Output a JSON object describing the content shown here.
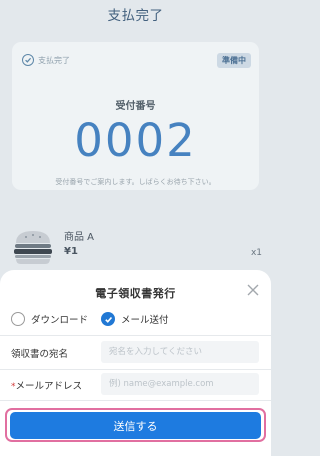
{
  "header": {
    "title": "支払完了"
  },
  "order": {
    "status_text": "支払完了",
    "status_badge": "準備中",
    "receipt_label": "受付番号",
    "receipt_number": "0002",
    "note": "受付番号でご案内します。しばらくお待ち下さい。",
    "colors": {
      "accent": "#4682c0",
      "card_bg": "#eff3f5"
    }
  },
  "item": {
    "icon": "burger-icon",
    "name": "商品 A",
    "price": "¥1",
    "quantity": "x1"
  },
  "receipt_dialog": {
    "title": "電子領収書発行",
    "close_icon": "close-icon",
    "options": [
      {
        "label": "ダウンロード",
        "selected": false
      },
      {
        "label": "メール送付",
        "selected": true
      }
    ],
    "fields": {
      "addressee": {
        "label": "領収書の宛名",
        "value": "",
        "placeholder": "宛名を入力してください"
      },
      "email": {
        "required_mark": "*",
        "label": "メールアドレス",
        "value": "",
        "placeholder": "例) name@example.com"
      }
    },
    "send_label": "送信する",
    "colors": {
      "primary": "#1e7be0",
      "highlight": "#e16fa0",
      "required": "#d23c3c"
    }
  }
}
